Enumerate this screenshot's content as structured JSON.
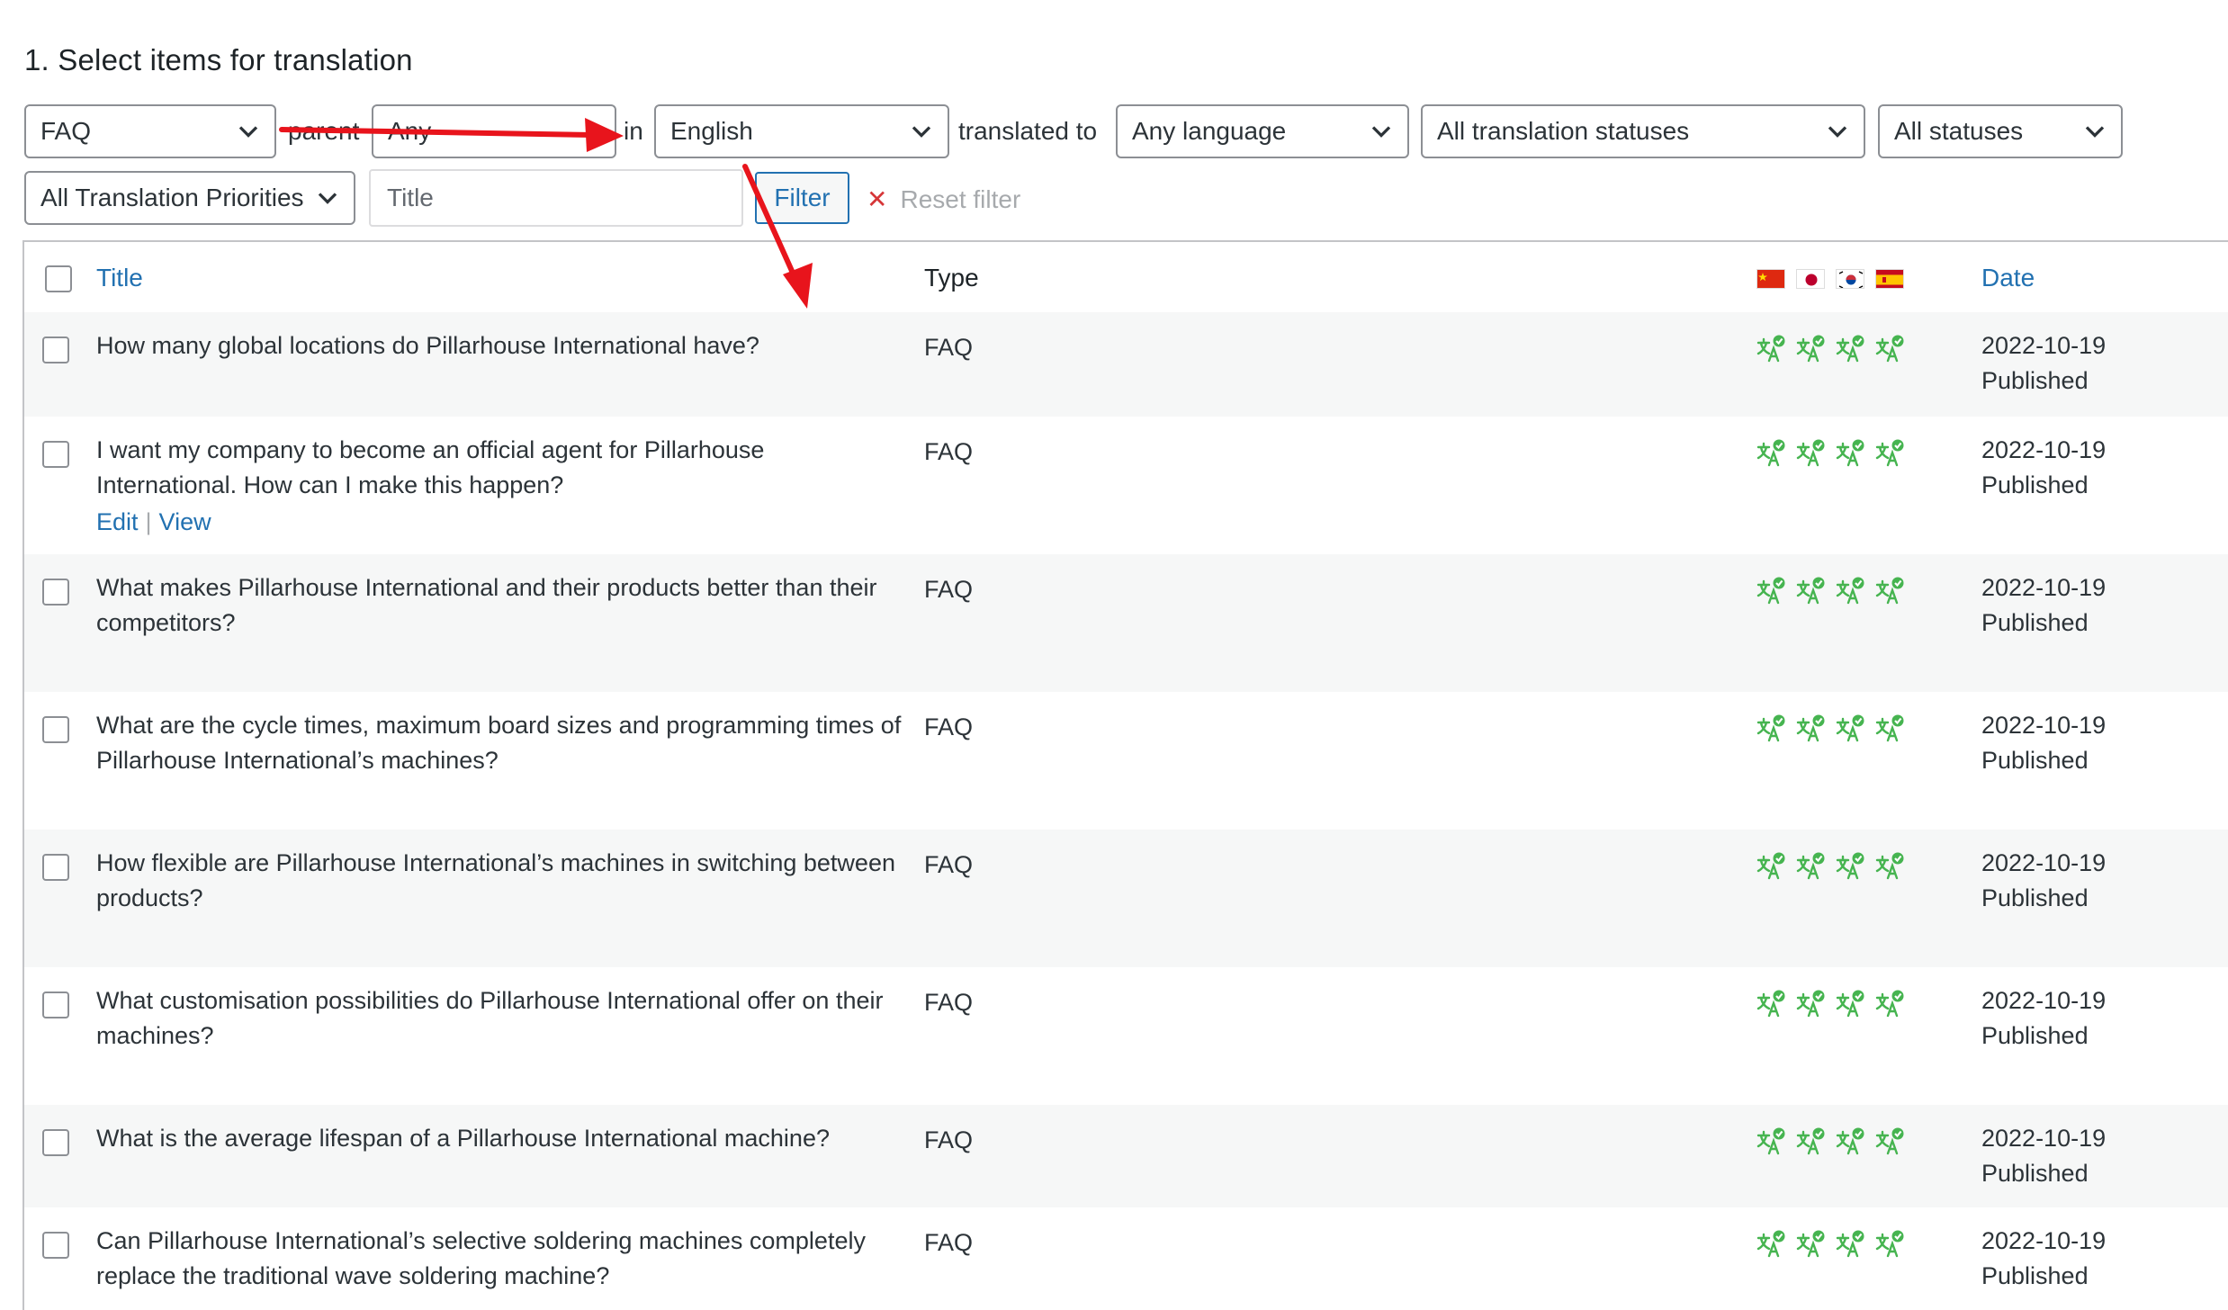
{
  "section_title": "1. Select items for translation",
  "filters": {
    "type_select": "FAQ",
    "parent_label": "parent",
    "parent_select": "Any",
    "in_label": "in",
    "language_select": "English",
    "translated_to_label": "translated to",
    "target_language_select": "Any language",
    "translation_status_select": "All translation statuses",
    "status_select": "All statuses",
    "priority_select": "All Translation Priorities",
    "title_placeholder": "Title",
    "filter_button": "Filter",
    "reset_filter": "Reset filter"
  },
  "table": {
    "headers": {
      "title": "Title",
      "type": "Type",
      "date": "Date"
    },
    "flags": [
      "china-flag",
      "japan-flag",
      "korea-flag",
      "spain-flag"
    ],
    "icon_color": "#46b450",
    "row_actions": {
      "edit": "Edit",
      "sep": "|",
      "view": "View"
    },
    "rows": [
      {
        "title": "How many global locations do Pillarhouse International have?",
        "type": "FAQ",
        "date": "2022-10-19",
        "status": "Published"
      },
      {
        "title": "I want my company to become an official agent for Pillarhouse International. How can I make this happen?",
        "type": "FAQ",
        "date": "2022-10-19",
        "status": "Published"
      },
      {
        "title": "What makes Pillarhouse International and their products better than their competitors?",
        "type": "FAQ",
        "date": "2022-10-19",
        "status": "Published"
      },
      {
        "title": "What are the cycle times, maximum board sizes and programming times of Pillarhouse International’s machines?",
        "type": "FAQ",
        "date": "2022-10-19",
        "status": "Published"
      },
      {
        "title": "How flexible are Pillarhouse International’s machines in switching between products?",
        "type": "FAQ",
        "date": "2022-10-19",
        "status": "Published"
      },
      {
        "title": "What customisation possibilities do Pillarhouse International offer on their machines?",
        "type": "FAQ",
        "date": "2022-10-19",
        "status": "Published"
      },
      {
        "title": "What is the average lifespan of a Pillarhouse International machine?",
        "type": "FAQ",
        "date": "2022-10-19",
        "status": "Published"
      },
      {
        "title": "Can Pillarhouse International’s selective soldering machines completely replace the traditional wave soldering machine?",
        "type": "FAQ",
        "date": "2022-10-19",
        "status": "Published"
      }
    ]
  },
  "annotation_color": "#e8141c"
}
